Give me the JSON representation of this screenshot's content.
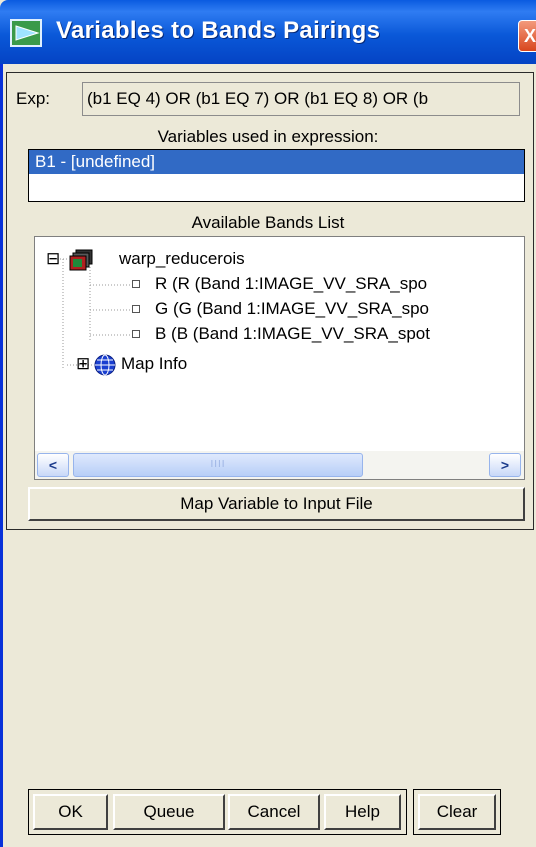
{
  "window": {
    "title": "Variables to Bands Pairings",
    "close_glyph": "X",
    "title_icon": "envi-dialog-icon"
  },
  "expression": {
    "label": "Exp:",
    "value": "(b1 EQ 4) OR (b1 EQ 7) OR (b1 EQ 8) OR (b"
  },
  "variables": {
    "label": "Variables used in expression:",
    "items": [
      "B1 - [undefined]"
    ],
    "selected_index": 0
  },
  "bands": {
    "label": "Available Bands List",
    "tree": {
      "root": {
        "expander": "⊟",
        "label": "warp_reducerois",
        "icon": "raster-file-icon"
      },
      "children": [
        {
          "label": "R (R (Band 1:IMAGE_VV_SRA_spo",
          "icon": "band-icon"
        },
        {
          "label": "G (G (Band 1:IMAGE_VV_SRA_spo",
          "icon": "band-icon"
        },
        {
          "label": "B (B (Band 1:IMAGE_VV_SRA_spot",
          "icon": "band-icon"
        }
      ],
      "map_info": {
        "expander": "⊞",
        "label": "Map Info",
        "icon": "globe-icon"
      }
    },
    "scrollbar": {
      "left_arrow": "<",
      "right_arrow": ">",
      "grip": "IIII"
    }
  },
  "buttons": {
    "map_variable": "Map Variable to Input File",
    "ok": "OK",
    "queue": "Queue",
    "cancel": "Cancel",
    "help": "Help",
    "clear": "Clear"
  },
  "colors": {
    "titlebar": "#0a58d8",
    "selection": "#316ac5",
    "dialog_bg": "#ece9d8"
  }
}
